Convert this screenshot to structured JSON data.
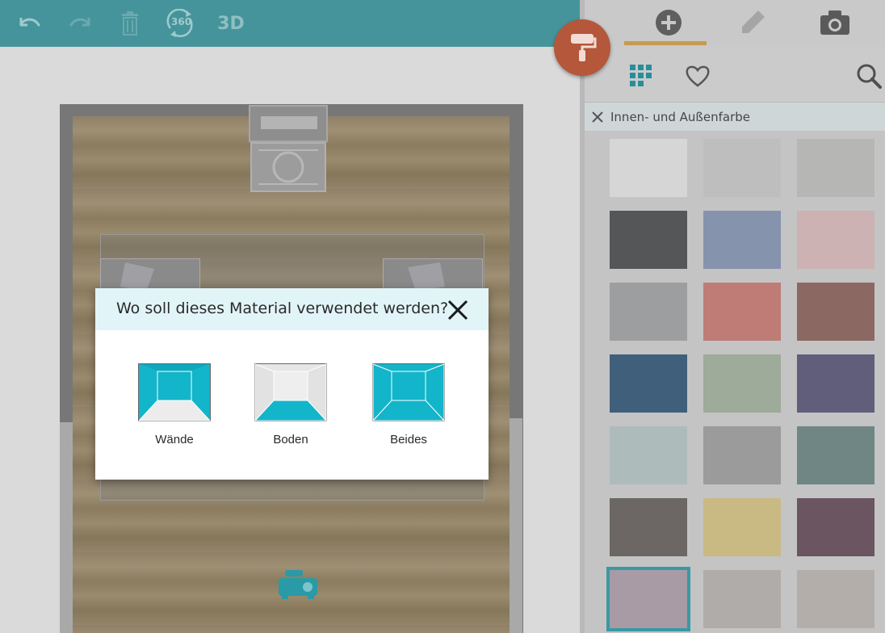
{
  "toolbar": {
    "icons": [
      "undo-icon",
      "redo-icon",
      "trash-icon",
      "rotate-360-icon"
    ],
    "deg360_label": "360",
    "view3d_label": "3D"
  },
  "fab": {
    "icon": "paint-roller-icon",
    "color": "#b4573a"
  },
  "panel": {
    "tabs": [
      {
        "icon": "plus-circle-icon",
        "active": true
      },
      {
        "icon": "pencil-icon",
        "active": false
      },
      {
        "icon": "camera-icon",
        "active": false
      }
    ],
    "tools": [
      "grid-icon",
      "heart-icon",
      "search-icon"
    ],
    "filter_label": "Innen- und Außenfarbe",
    "swatches": [
      {
        "color": "#d6d6d6",
        "selected": false
      },
      {
        "color": "#bebebe",
        "selected": false
      },
      {
        "color": "#b6b6b4",
        "selected": false
      },
      {
        "color": "#555658",
        "selected": false
      },
      {
        "color": "#8693ad",
        "selected": false
      },
      {
        "color": "#ccb2b2",
        "selected": false
      },
      {
        "color": "#9c9e9f",
        "selected": false
      },
      {
        "color": "#bf7b76",
        "selected": false
      },
      {
        "color": "#8c6862",
        "selected": false
      },
      {
        "color": "#405f7b",
        "selected": false
      },
      {
        "color": "#9eaa9a",
        "selected": false
      },
      {
        "color": "#605e7a",
        "selected": false
      },
      {
        "color": "#adbcbb",
        "selected": false
      },
      {
        "color": "#9b9b9b",
        "selected": false
      },
      {
        "color": "#6f8684",
        "selected": false
      },
      {
        "color": "#6c6764",
        "selected": false
      },
      {
        "color": "#c9b983",
        "selected": false
      },
      {
        "color": "#6a5560",
        "selected": false
      },
      {
        "color": "#a89ba5",
        "selected": true
      },
      {
        "color": "#b0acaa",
        "selected": false
      },
      {
        "color": "#b4aeaa",
        "selected": false
      }
    ],
    "selection_color": "#3a98a3"
  },
  "dialog": {
    "title": "Wo soll dieses Material verwendet werden?",
    "options": [
      {
        "label": "Wände",
        "icon": "walls-icon"
      },
      {
        "label": "Boden",
        "icon": "floor-icon"
      },
      {
        "label": "Beides",
        "icon": "walls-and-floor-icon"
      }
    ],
    "accent": "#12b5ca"
  }
}
